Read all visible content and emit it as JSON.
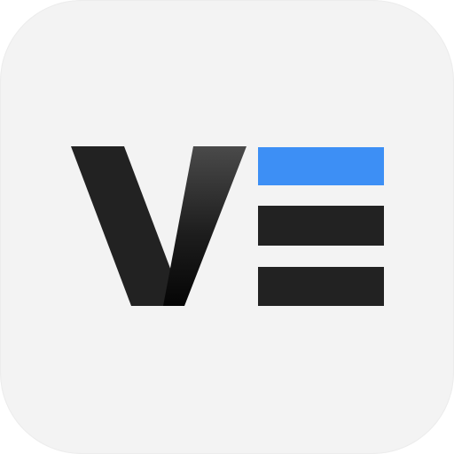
{
  "icon": {
    "semantic": "app-logo-icon",
    "background_color": "#f3f3f3",
    "letter_color": "#222222",
    "letter_shadow_color": "#050505",
    "letter_highlight_color": "#4a4a4a",
    "bars": [
      {
        "name": "top-bar",
        "color": "#3d8ff5"
      },
      {
        "name": "middle-bar",
        "color": "#222222"
      },
      {
        "name": "bottom-bar",
        "color": "#222222"
      }
    ]
  }
}
